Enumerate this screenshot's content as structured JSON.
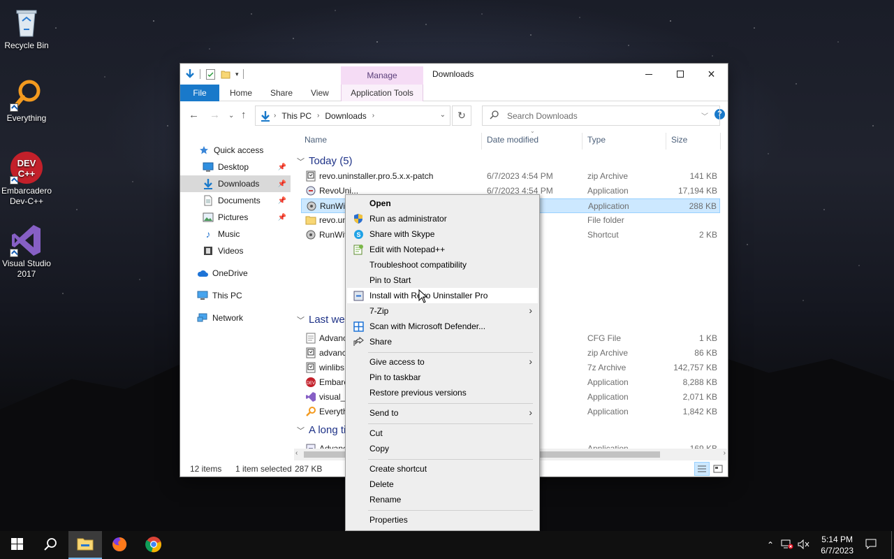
{
  "desktop": {
    "icons": [
      {
        "label": "Recycle Bin"
      },
      {
        "label": "Everything"
      },
      {
        "label": "Embarcadero Dev-C++"
      },
      {
        "label": "Visual Studio 2017"
      }
    ]
  },
  "window": {
    "title": "Downloads",
    "manage_tab": "Manage",
    "ribbon_tabs": [
      "File",
      "Home",
      "Share",
      "View",
      "Application Tools"
    ],
    "breadcrumb": [
      "This PC",
      "Downloads"
    ],
    "search_placeholder": "Search Downloads",
    "help_label": "?"
  },
  "nav": {
    "quick_access": "Quick access",
    "items": [
      {
        "label": "Desktop",
        "pinned": true
      },
      {
        "label": "Downloads",
        "pinned": true,
        "selected": true
      },
      {
        "label": "Documents",
        "pinned": true
      },
      {
        "label": "Pictures",
        "pinned": true
      },
      {
        "label": "Music"
      },
      {
        "label": "Videos"
      }
    ],
    "onedrive": "OneDrive",
    "thispc": "This PC",
    "network": "Network"
  },
  "columns": {
    "name": "Name",
    "date": "Date modified",
    "type": "Type",
    "size": "Size"
  },
  "groups": {
    "today": "Today (5)",
    "lastweek": "Last wee",
    "longtime": "A long ti"
  },
  "files": [
    {
      "name": "revo.uninstaller.pro.5.x.x-patch",
      "date": "6/7/2023 4:54 PM",
      "type": "zip Archive",
      "size": "141 KB"
    },
    {
      "name": "RevoUni...",
      "date": "6/7/2023 4:54 PM",
      "type": "Application",
      "size": "17,194 KB"
    },
    {
      "name": "RunWit",
      "date": "PM",
      "type": "Application",
      "size": "288 KB"
    },
    {
      "name": "revo.un",
      "date": "PM",
      "type": "File folder",
      "size": ""
    },
    {
      "name": "RunWit",
      "date": "PM",
      "type": "Shortcut",
      "size": "2 KB"
    },
    {
      "name": "Advanc",
      "date": "PM",
      "type": "CFG File",
      "size": "1 KB"
    },
    {
      "name": "advanc",
      "date": "PM",
      "type": "zip Archive",
      "size": "86 KB"
    },
    {
      "name": "winlibs",
      "date": "PM",
      "type": "7z Archive",
      "size": "142,757 KB"
    },
    {
      "name": "Embarc",
      "date": "PM",
      "type": "Application",
      "size": "8,288 KB"
    },
    {
      "name": "visual_s",
      "date": "PM",
      "type": "Application",
      "size": "2,071 KB"
    },
    {
      "name": "Everyth",
      "date": "PM",
      "type": "Application",
      "size": "1,842 KB"
    },
    {
      "name": "Advanc",
      "date": "PM",
      "type": "Application",
      "size": "169 KB"
    }
  ],
  "status": {
    "items": "12 items",
    "selected": "1 item selected",
    "size": "287 KB"
  },
  "context_menu": {
    "items": [
      {
        "label": "Open"
      },
      {
        "label": "Run as administrator"
      },
      {
        "label": "Share with Skype"
      },
      {
        "label": "Edit with Notepad++"
      },
      {
        "label": "Troubleshoot compatibility"
      },
      {
        "label": "Pin to Start"
      },
      {
        "label": "Install with Revo Uninstaller Pro"
      },
      {
        "label": "7-Zip"
      },
      {
        "label": "Scan with Microsoft Defender..."
      },
      {
        "label": "Share"
      },
      {
        "label": "Give access to"
      },
      {
        "label": "Pin to taskbar"
      },
      {
        "label": "Restore previous versions"
      },
      {
        "label": "Send to"
      },
      {
        "label": "Cut"
      },
      {
        "label": "Copy"
      },
      {
        "label": "Create shortcut"
      },
      {
        "label": "Delete"
      },
      {
        "label": "Rename"
      },
      {
        "label": "Properties"
      }
    ]
  },
  "taskbar": {
    "time": "5:14 PM",
    "date": "6/7/2023"
  },
  "colors": {
    "accent": "#1979ca",
    "selection": "#cce8ff",
    "manage": "#f5dcf5"
  }
}
